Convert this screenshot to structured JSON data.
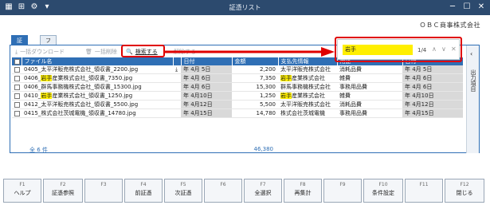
{
  "window": {
    "title": "証憑リスト"
  },
  "company": "ＯＢＣ商事株式会社",
  "tabs": [
    {
      "label": "証憑"
    },
    {
      "label": "ファイルリンク"
    }
  ],
  "toolbar": {
    "bulk_download": "一括ダウンロード",
    "bulk_delete": "一括削除",
    "search": "検索する",
    "clear": "解除する"
  },
  "find": {
    "query": "岩手",
    "count": "1/4"
  },
  "table": {
    "headers": [
      "ファイル名",
      "日付",
      "金額",
      "支払先情報",
      "用途",
      "日付"
    ],
    "rows": [
      {
        "pre": "0405_太平洋販売株式会社_領収書_2200.jpg",
        "hl": "",
        "post": "",
        "date": "年 4月 5日",
        "amount": "2,200",
        "vendor_pre": "",
        "vendor_hl": "",
        "vendor": "太平洋販売株式会社",
        "use": "消耗品費",
        "date2": "年 4月 5日"
      },
      {
        "pre": "0406_",
        "hl": "岩手",
        "post": "産業株式会社_領収書_7350.jpg",
        "date": "年 4月 6日",
        "amount": "7,350",
        "vendor_pre": "",
        "vendor_hl": "岩手",
        "vendor": "産業株式会社",
        "use": "雑費",
        "date2": "年 4月 6日"
      },
      {
        "pre": "0406_群馬事務機株式会社_領収書_15300.jpg",
        "hl": "",
        "post": "",
        "date": "年 4月 6日",
        "amount": "15,300",
        "vendor_pre": "",
        "vendor_hl": "",
        "vendor": "群馬事務機株式会社",
        "use": "事務用品費",
        "date2": "年 4月 6日"
      },
      {
        "pre": "0410_",
        "hl": "岩手",
        "post": "産業株式会社_領収書_1250.jpg",
        "date": "年 4月10日",
        "amount": "1,250",
        "vendor_pre": "",
        "vendor_hl": "岩手",
        "vendor": "産業株式会社",
        "use": "雑費",
        "date2": "年 4月10日"
      },
      {
        "pre": "0412_太平洋販売株式会社_領収書_5500.jpg",
        "hl": "",
        "post": "",
        "date": "年 4月12日",
        "amount": "5,500",
        "vendor_pre": "",
        "vendor_hl": "",
        "vendor": "太平洋販売株式会社",
        "use": "消耗品費",
        "date2": "年 4月12日"
      },
      {
        "pre": "0415_株式会社茨城電機_領収書_14780.jpg",
        "hl": "",
        "post": "",
        "date": "年 4月15日",
        "amount": "14,780",
        "vendor_pre": "",
        "vendor_hl": "",
        "vendor": "株式会社茨城電機",
        "use": "事務用品費",
        "date2": "年 4月15日"
      }
    ],
    "total_label": "全 6 件",
    "total_amount": "46,380"
  },
  "side_panel": {
    "label": "出力項目"
  },
  "fkeys": [
    {
      "key": "F1",
      "label": "ヘルプ"
    },
    {
      "key": "F2",
      "label": "証憑参照"
    },
    {
      "key": "F3",
      "label": ""
    },
    {
      "key": "F4",
      "label": "前証憑"
    },
    {
      "key": "F5",
      "label": "次証憑"
    },
    {
      "key": "F6",
      "label": ""
    },
    {
      "key": "F7",
      "label": "全選択"
    },
    {
      "key": "F8",
      "label": "再集計"
    },
    {
      "key": "F9",
      "label": ""
    },
    {
      "key": "F10",
      "label": "条件設定"
    },
    {
      "key": "F11",
      "label": ""
    },
    {
      "key": "F12",
      "label": "閉じる"
    }
  ]
}
